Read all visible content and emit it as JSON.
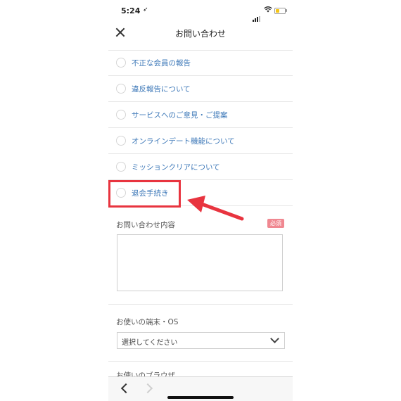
{
  "status_bar": {
    "time": "5:24",
    "location_glyph": "➶"
  },
  "header": {
    "title": "お問い合わせ",
    "close_icon": "close-icon"
  },
  "options": [
    {
      "label": "不正な会員の報告"
    },
    {
      "label": "違反報告について"
    },
    {
      "label": "サービスへのご意見・ご提案"
    },
    {
      "label": "オンラインデート機能について"
    },
    {
      "label": "ミッションクリアについて"
    },
    {
      "label": "退会手続き"
    }
  ],
  "inquiry": {
    "label": "お問い合わせ内容",
    "required_badge": "必須",
    "value": ""
  },
  "device": {
    "label": "お使いの端末・OS",
    "select_value": "選択してください"
  },
  "next_section_label": "お使いのブラウザ",
  "colors": {
    "link": "#3d78b8",
    "highlight": "#e8343f",
    "required": "#f08891"
  }
}
